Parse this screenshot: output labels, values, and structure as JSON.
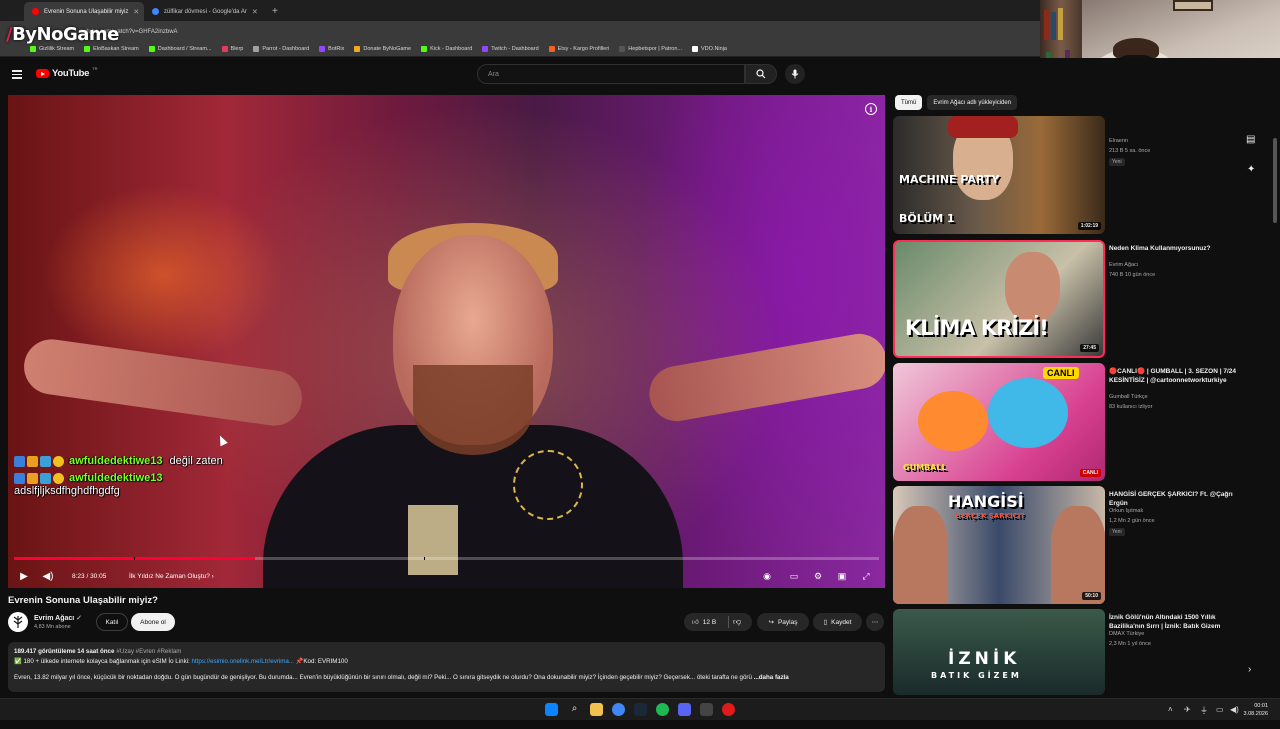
{
  "browser": {
    "tabs": [
      {
        "title": "Evrenin Sonuna Ulaşabilir miyiz",
        "active": true,
        "fav_color": "#ff0000"
      },
      {
        "title": "zülfikar dövmesi - Google'da Ar",
        "active": false,
        "fav_color": "#4285f4"
      }
    ],
    "new_tab": "+",
    "url": "outube.com/watch?v=GHFA2inzbwA",
    "bookmarks": [
      {
        "label": "Gizlilik Stream",
        "color": "#53fc18"
      },
      {
        "label": "EloBaskan Stream",
        "color": "#53fc18"
      },
      {
        "label": "Dashboard / Stream...",
        "color": "#53fc18"
      },
      {
        "label": "Blerp",
        "color": "#e63a5b"
      },
      {
        "label": "Parrot - Dashboard",
        "color": "#a0a0a0"
      },
      {
        "label": "BotRix",
        "color": "#9146ff"
      },
      {
        "label": "Donate ByNoGame",
        "color": "#f5a623"
      },
      {
        "label": "Kick - Dashboard",
        "color": "#53fc18"
      },
      {
        "label": "Twitch - Dashboard",
        "color": "#9146ff"
      },
      {
        "label": "Etsy - Kargo Profilleri",
        "color": "#f1641e"
      },
      {
        "label": "Hepbetspor | Patron...",
        "color": "#555555"
      },
      {
        "label": "VDO.Ninja",
        "color": "#ffffff"
      }
    ]
  },
  "overlay_logo": {
    "slash": "/",
    "text": "ByNoGame"
  },
  "youtube": {
    "logo_text": "YouTube",
    "logo_region": "TR",
    "search_placeholder": "Ara",
    "video": {
      "title": "Evrenin Sonuna Ulaşabilir miyiz?",
      "current_time": "8:23 / 30:05",
      "chapter": "İlk Yıldız Ne Zaman Oluştu?",
      "progress": 0.279,
      "channel": "Evrim Ağacı",
      "subscribers": "4,83 Mn abone",
      "join": "Katıl",
      "subscribe": "Abone ol",
      "likes": "12 B",
      "share": "Paylaş",
      "save": "Kaydet",
      "description": {
        "stats": "189.417 görüntüleme  14 saat önce",
        "tags": "#Uzay #Evren #Reklam",
        "line2_prefix": "180 + ülkede internete kolayca bağlanmak için eSIM İo Linki:",
        "line2_link": "https://esimio.onelink.me/Ltr/evrima...",
        "line2_suffix": "Kod: EVRIM100",
        "line3": "Evren, 13.82 milyar yıl önce, küçücük bir noktadan doğdu. O gün bugündür de genişliyor. Bu durumda... Evren'in büyüklüğünün bir sınırı olmalı, değil mi? Peki... O sınıra gitseydik ne olurdu? Ona dokunabilir miyiz? İçinden geçebilir miyiz? Geçersek... öteki tarafta ne görü",
        "more": "...daha fazla"
      }
    },
    "chat": [
      {
        "user": "awfuldedektiwe13",
        "message": "değil zaten"
      },
      {
        "user": "awfuldedektiwe13",
        "message": "adslfjljksdfhghdfhgdfg"
      }
    ],
    "chips": [
      "Tümü",
      "Evrim Ağacı adlı yükleyiciden"
    ],
    "recommendations": [
      {
        "thumb_text": "MACHINE PARTY",
        "thumb_sub": "BÖLÜM 1",
        "duration": "1:02:19",
        "title": "",
        "channel": "Elraenn",
        "meta": "213 B  5 sa. önce",
        "badge": "Yeni"
      },
      {
        "thumb_text": "KLİMA KRİZİ!",
        "thumb_sub": "",
        "duration": "27:45",
        "title": "Neden Klima Kullanmıyorsunuz?",
        "channel": "Evrim Ağacı",
        "meta": "740 B  10 gün önce",
        "badge": ""
      },
      {
        "thumb_text": "CANLI",
        "thumb_sub": "GUMBALL",
        "duration": "CANLI",
        "title": "🔴CANLI🔴 | GUMBALL | 3. SEZON | 7/24 KESİNTİSİZ | @cartoonnetworkturkiye",
        "channel": "Gumball Türkçe",
        "meta": "83 kullanıcı izliyor",
        "badge": ""
      },
      {
        "thumb_text": "HANGİSİ",
        "thumb_sub": "GERÇEK ŞARKICI?",
        "duration": "50:10",
        "title": "HANGİSİ GERÇEK ŞARKICI? Ft. @Çağrı Ergün",
        "channel": "Orkun Işıtmak",
        "meta": "1,2 Mn  2 gün önce",
        "badge": "Yeni"
      },
      {
        "thumb_text": "İZNİK",
        "thumb_sub": "BATIK GİZEM",
        "duration": "",
        "title": "İznik Gölü'nün Altındaki 1500 Yıllık Bazilika'nın Sırrı | İznik: Batık Gizem",
        "channel": "DMAX Türkiye",
        "meta": "2,3 Mn  1 yıl önce",
        "badge": ""
      }
    ]
  },
  "taskbar": {
    "time": "00:01",
    "date": "3.08.2026"
  },
  "colors": {
    "accent": "#ff0033",
    "chat_user": "#7dff2a",
    "link": "#3ea6ff",
    "bg": "#0f0f0f"
  }
}
